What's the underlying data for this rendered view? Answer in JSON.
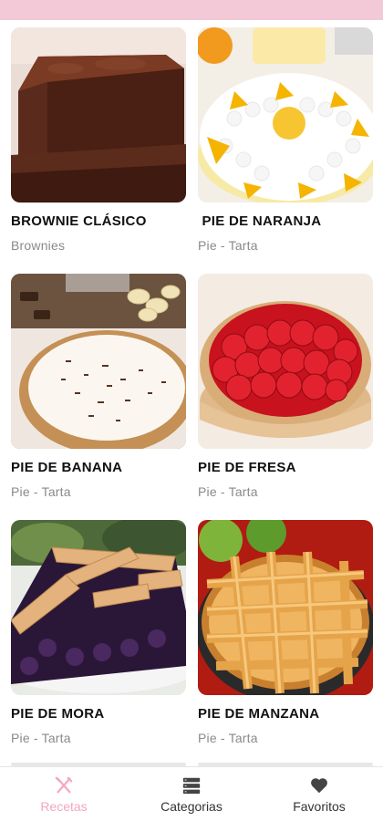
{
  "recipes": [
    {
      "title": "BROWNIE CLÁSICO",
      "category": "Brownies",
      "image": "brownie-photo"
    },
    {
      "title": " PIE DE NARANJA",
      "category": "Pie - Tarta",
      "image": "orange-pie-photo"
    },
    {
      "title": "PIE DE BANANA",
      "category": "Pie - Tarta",
      "image": "banana-pie-photo"
    },
    {
      "title": "PIE DE FRESA",
      "category": "Pie - Tarta",
      "image": "strawberry-pie-photo"
    },
    {
      "title": "PIE DE MORA",
      "category": "Pie - Tarta",
      "image": "blackberry-pie-photo"
    },
    {
      "title": "PIE DE MANZANA",
      "category": "Pie - Tarta",
      "image": "apple-pie-photo"
    }
  ],
  "nav": [
    {
      "label": "Recetas",
      "icon": "utensils-icon",
      "active": true
    },
    {
      "label": "Categorias",
      "icon": "list-icon",
      "active": false
    },
    {
      "label": "Favoritos",
      "icon": "heart-icon",
      "active": false
    }
  ],
  "colors": {
    "topbar": "#f4c9d7",
    "active_nav": "#f3a7bf",
    "subtitle": "#8a8a8a"
  }
}
